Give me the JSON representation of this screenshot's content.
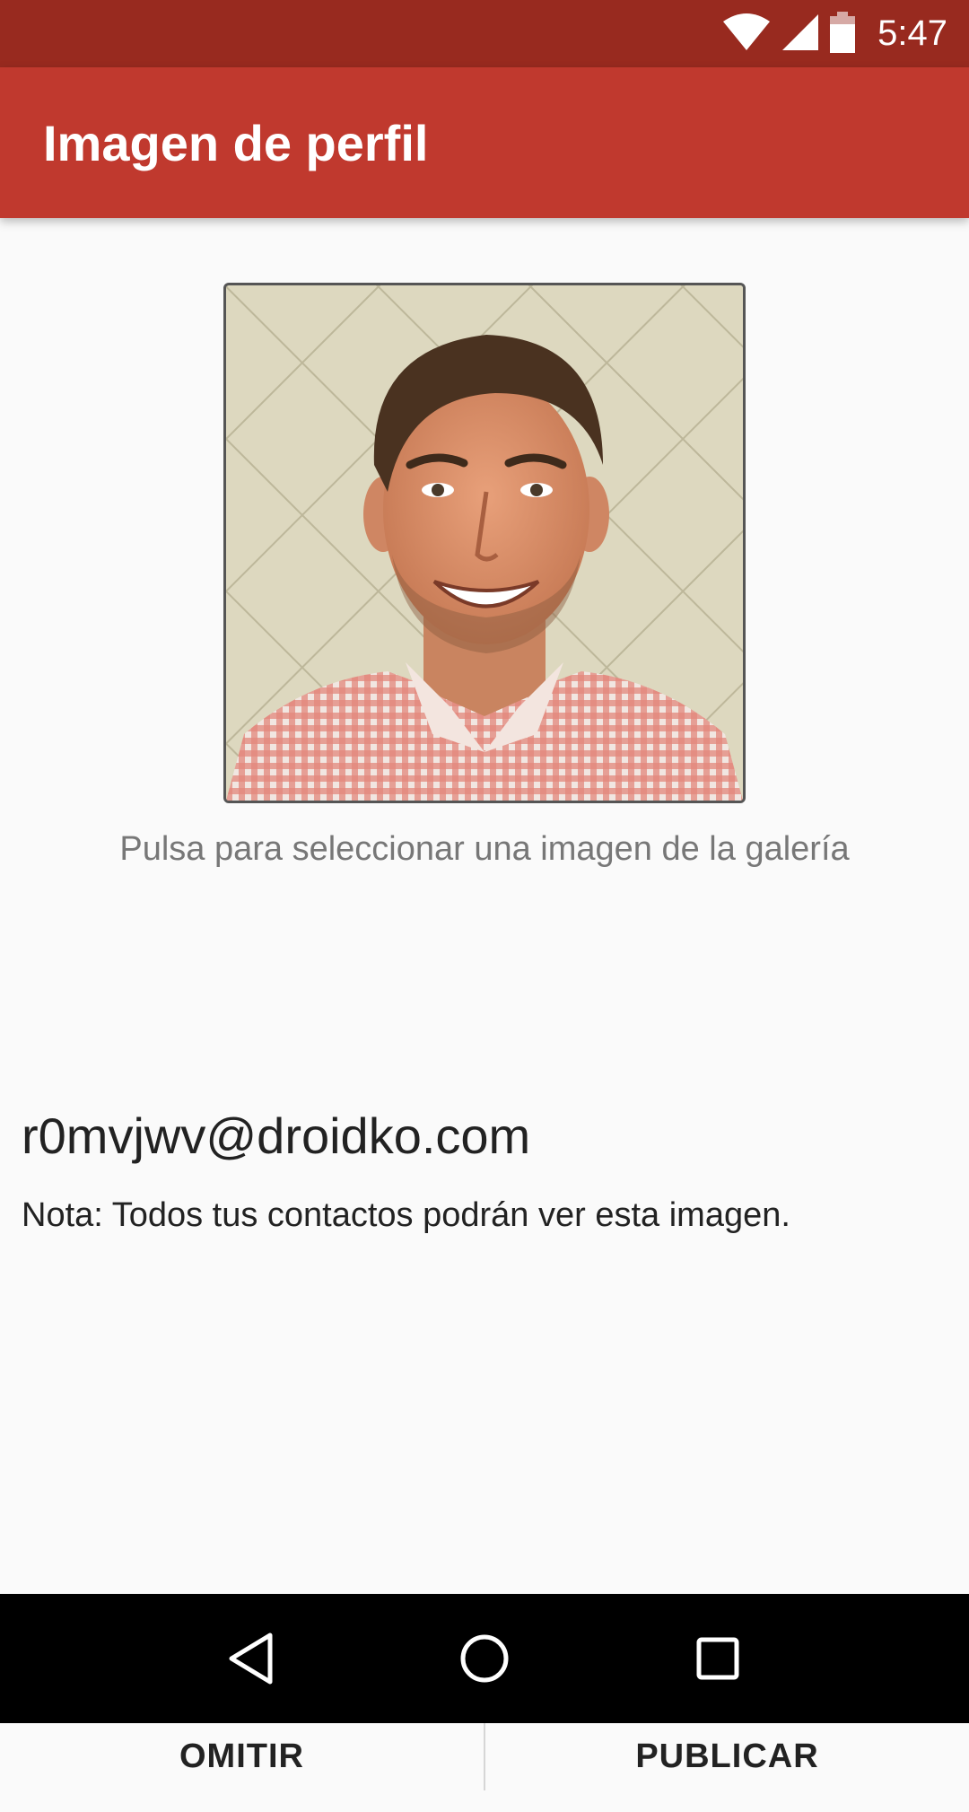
{
  "status_bar": {
    "time": "5:47",
    "icons": [
      "wifi-icon",
      "cell-signal-icon",
      "battery-icon"
    ],
    "background": "#982a1f"
  },
  "app_bar": {
    "title": "Imagen de perfil",
    "background": "#c0392e"
  },
  "profile": {
    "avatar_alt": "profile-photo",
    "pick_hint": "Pulsa para seleccionar una imagen de la galería",
    "email": "r0mvjwv@droidko.com",
    "note": "Nota: Todos tus contactos podrán ver esta imagen."
  },
  "actions": {
    "skip_label": "OMITIR",
    "publish_label": "PUBLICAR"
  },
  "nav_bar": {
    "buttons": [
      "back-icon",
      "home-icon",
      "recents-icon"
    ]
  }
}
